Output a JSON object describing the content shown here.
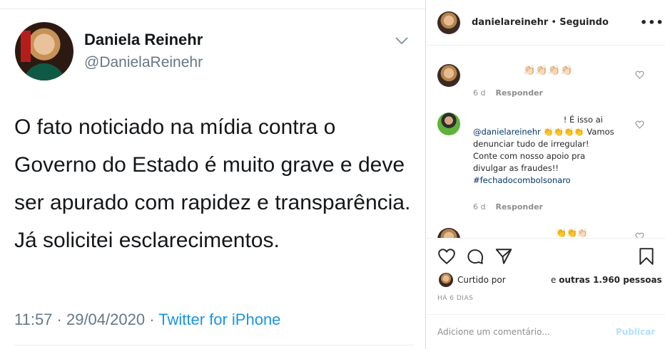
{
  "tweet": {
    "name": "Daniela Reinehr",
    "handle": "@DanielaReinehr",
    "text": "O fato noticiado na mídia contra o Governo do Estado é muito grave e deve ser apurado com rapidez e transparência. Já solicitei esclarecimentos.",
    "timestamp": "11:57 · 29/04/2020 · ",
    "source": "Twitter for iPhone",
    "colors": {
      "source": "#1b95e0",
      "secondary_text": "#657786"
    }
  },
  "instagram": {
    "header": {
      "username": "danielareinehr",
      "separator": " • ",
      "status": "Seguindo",
      "more_icon": "more-icon"
    },
    "comments": [
      {
        "avatar_icon": "commenter-avatar",
        "text": "👏🏻👏🏻👏🏻👏🏻",
        "age": "6 d",
        "reply_label": "Responder"
      },
      {
        "avatar_icon": "commenter-avatar",
        "first_line": "! É isso ai",
        "mention": "@danielareinehr",
        "emojis": " 👏👏👏👏",
        "body": "Vamos denunciar tudo de irregular! Conte com nosso apoio pra divulgar as fraudes!!",
        "hashtag": "#fechadocombolsonaro",
        "age": "6 d",
        "reply_label": "Responder"
      },
      {
        "avatar_icon": "commenter-avatar",
        "text": "👏👏👏🏻"
      }
    ],
    "likes": {
      "prefix": "Curtido por",
      "suffix_prefix": "e ",
      "count_text": "outras 1.960 pessoas"
    },
    "post_age": "HÁ 6 DIAS",
    "add_comment": {
      "placeholder": "Adicione um comentário...",
      "publish_label": "Publicar"
    },
    "colors": {
      "link": "#00376b",
      "muted": "#8e8e8e",
      "publish_disabled": "#b2dffc"
    }
  }
}
